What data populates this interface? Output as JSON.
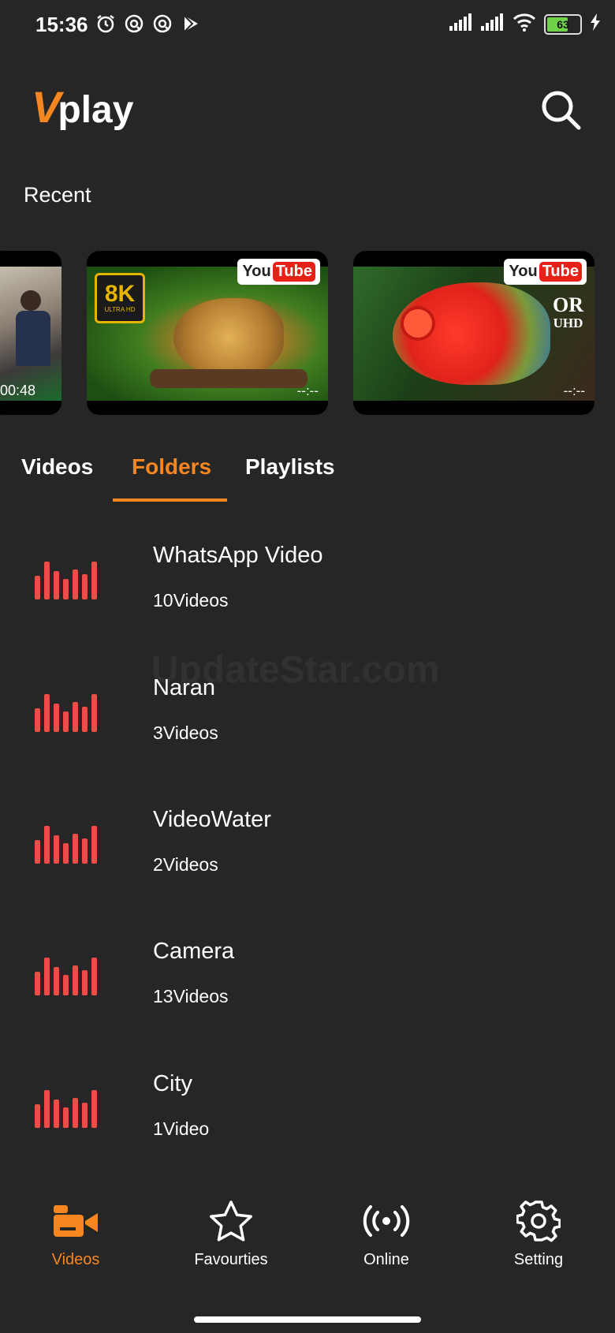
{
  "status_bar": {
    "time": "15:36",
    "battery": "63",
    "icons": [
      "alarm-icon",
      "notification-icon",
      "notification-icon",
      "play-store-icon",
      "signal-icon",
      "signal-icon",
      "wifi-icon",
      "battery-icon",
      "charging-icon"
    ]
  },
  "app": {
    "logo_v": "V",
    "logo_play": "play",
    "search_icon": "search-icon"
  },
  "recent": {
    "title": "Recent",
    "items": [
      {
        "duration": "00:48",
        "thumb": "people-scene"
      },
      {
        "duration": "--:--",
        "source": "YouTube",
        "badge": "8K",
        "badge_sub": "ULTRA HD",
        "thumb": "jaguar"
      },
      {
        "duration": "--:--",
        "source": "YouTube",
        "overlay_big": "OR",
        "overlay_small": "UHD",
        "thumb": "chameleon"
      }
    ]
  },
  "youtube": {
    "you": "You",
    "tube": "Tube"
  },
  "tabs": [
    {
      "label": "Videos",
      "active": false
    },
    {
      "label": "Folders",
      "active": true
    },
    {
      "label": "Playlists",
      "active": false
    }
  ],
  "folders": [
    {
      "name": "WhatsApp Video",
      "count": "10Videos"
    },
    {
      "name": "Naran",
      "count": "3Videos"
    },
    {
      "name": "VideoWater",
      "count": "2Videos"
    },
    {
      "name": "Camera",
      "count": "13Videos"
    },
    {
      "name": "City",
      "count": "1Video"
    }
  ],
  "watermark": "UpdateStar.com",
  "bottom_nav": [
    {
      "label": "Videos",
      "icon": "video-camera-icon",
      "active": true
    },
    {
      "label": "Favourties",
      "icon": "star-icon",
      "active": false
    },
    {
      "label": "Online",
      "icon": "broadcast-icon",
      "active": false
    },
    {
      "label": "Setting",
      "icon": "gear-icon",
      "active": false
    }
  ],
  "colors": {
    "accent": "#f6861f",
    "background": "#262626",
    "equalizer": "#ef4b4b"
  }
}
